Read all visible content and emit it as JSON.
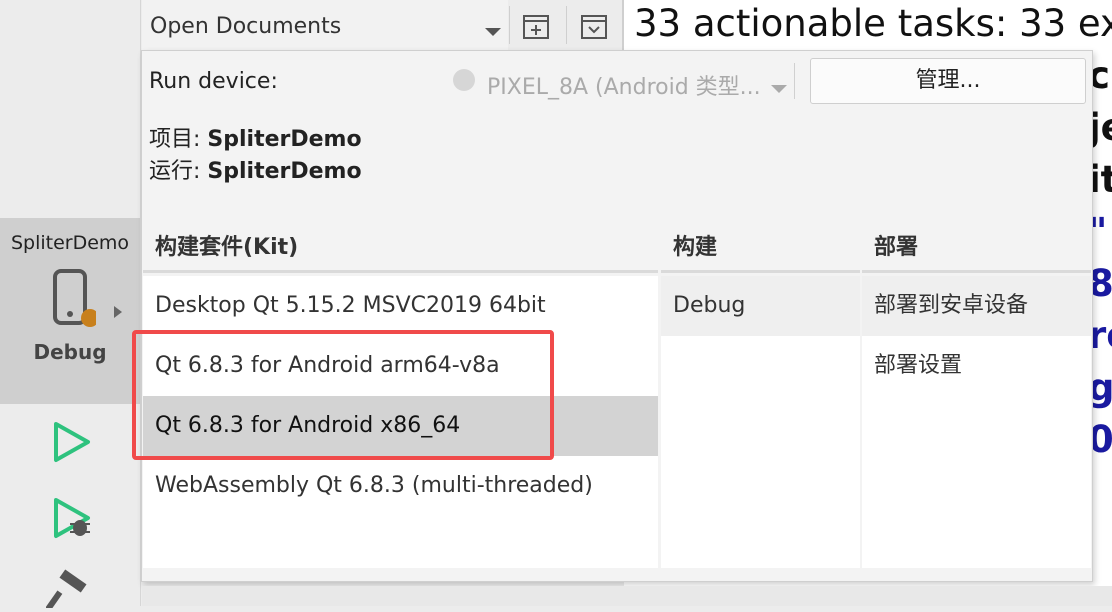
{
  "mode_bar": {
    "project_name": "SpliterDemo",
    "config_label": "Debug",
    "icons": [
      "phone-icon",
      "run-icon",
      "debug-run-icon",
      "build-hammer-icon"
    ]
  },
  "toolbar": {
    "open_documents": "Open Documents"
  },
  "output": {
    "header": "33 actionable tasks: 33 exe",
    "lines": [
      {
        "text": "c",
        "color": "#111111"
      },
      {
        "text": "je",
        "color": "#111111"
      },
      {
        "text": "it",
        "color": "#111111"
      },
      {
        "text": "\"",
        "color": "#1a1aa0"
      },
      {
        "text": "8",
        "color": "#1a1aa0"
      },
      {
        "text": "ro",
        "color": "#1a1aa0"
      },
      {
        "text": "g",
        "color": "#1a1aa0"
      },
      {
        "text": "0",
        "color": "#1a1aa0"
      }
    ]
  },
  "popup": {
    "run_device_label": "Run device:",
    "device_name": "PIXEL_8A (Android 类型...",
    "manage_button": "管理...",
    "project_prefix": "项目: ",
    "project_value": "SpliterDemo",
    "run_prefix": "运行: ",
    "run_value": "SpliterDemo",
    "columns": {
      "kit": "构建套件(Kit)",
      "build": "构建",
      "deploy": "部署"
    },
    "kits": [
      "Desktop Qt 5.15.2 MSVC2019 64bit",
      "Qt 6.8.3 for Android arm64-v8a",
      "Qt 6.8.3 for Android x86_64",
      "WebAssembly Qt 6.8.3 (multi-threaded)"
    ],
    "selected_kit": "Qt 6.8.3 for Android x86_64",
    "builds": [
      "Debug"
    ],
    "deploys": [
      "部署到安卓设备",
      "部署设置"
    ]
  },
  "colors": {
    "highlight": "#f04a4a",
    "run_green": "#2ec27e",
    "device_badge": "#c8801c"
  }
}
